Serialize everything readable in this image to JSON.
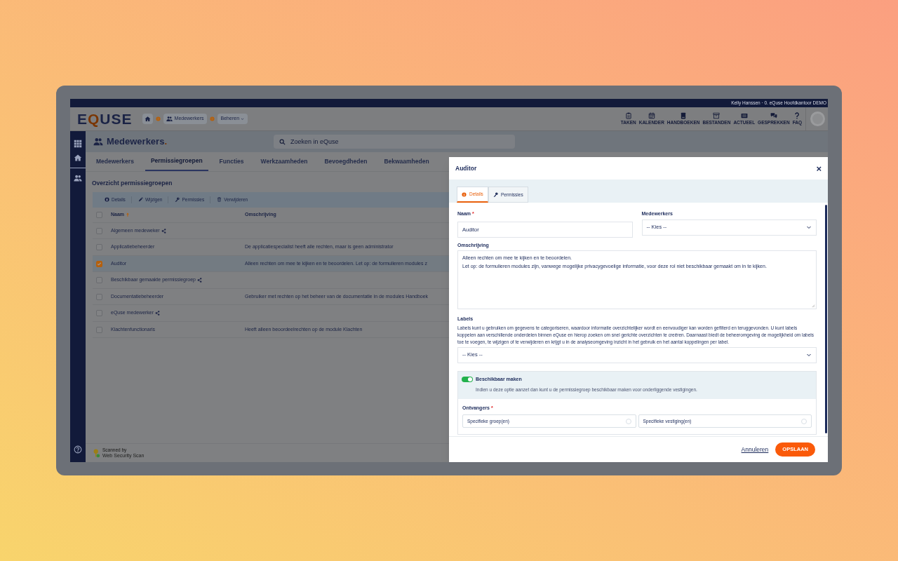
{
  "top_bar": {
    "user": "Kelly Hanssen · 0. eQuse Hoofdkantoor DEMO"
  },
  "header": {
    "logo": "EQUSE",
    "breadcrumbs": [
      {
        "kind": "home"
      },
      {
        "kind": "link",
        "label": "Medewerkers"
      },
      {
        "kind": "dropdown",
        "label": "Beheren"
      }
    ],
    "nav": [
      {
        "kind": "tasks",
        "label": "TAKEN"
      },
      {
        "kind": "calendar",
        "label": "KALENDER"
      },
      {
        "kind": "book",
        "label": "HANDBOEKEN"
      },
      {
        "kind": "archive",
        "label": "BESTANDEN"
      },
      {
        "kind": "news",
        "label": "ACTUEEL"
      },
      {
        "kind": "chat",
        "label": "GESPREKKEN"
      },
      {
        "kind": "faq",
        "label": "FAQ"
      }
    ]
  },
  "sidebar": {
    "items": [
      {
        "kind": "grid"
      },
      {
        "kind": "home"
      },
      {
        "kind": "users"
      }
    ],
    "help": {
      "kind": "help"
    }
  },
  "page": {
    "title": "Medewerkers",
    "title_mark": ".",
    "search": {
      "placeholder": "Zoeken in eQuse"
    },
    "tabs": [
      {
        "label": "Medewerkers",
        "selected": false
      },
      {
        "label": "Permissiegroepen",
        "selected": true
      },
      {
        "label": "Functies",
        "selected": false
      },
      {
        "label": "Werkzaamheden",
        "selected": false
      },
      {
        "label": "Bevoegdheden",
        "selected": false
      },
      {
        "label": "Bekwaamheden",
        "selected": false
      }
    ],
    "section_title": "Overzicht permissiegroepen",
    "toolbar": [
      {
        "kind": "info",
        "label": "Details"
      },
      {
        "kind": "edit",
        "label": "Wijzigen"
      },
      {
        "kind": "key",
        "label": "Permissies"
      },
      {
        "kind": "trash",
        "label": "Verwijderen"
      }
    ],
    "table": {
      "columns": [
        "Naam",
        "Omschrijving"
      ],
      "header_checked": false,
      "rows": [
        {
          "name": "Algemeen medeweker",
          "description": "",
          "checked": false,
          "selected": false,
          "shared": true
        },
        {
          "name": "Applicatiebeheerder",
          "description": "De applicatiespecialist heeft alle rechten, maar is geen administrator",
          "checked": false,
          "selected": false,
          "shared": false
        },
        {
          "name": "Auditor",
          "description": "Alleen rechten om mee te kijken en te beoordelen. Let op: de formulieren modules z",
          "checked": true,
          "selected": true,
          "shared": false
        },
        {
          "name": "Beschikbaar gemaakte permissiegroep",
          "description": "",
          "checked": false,
          "selected": false,
          "shared": true
        },
        {
          "name": "Documentatiebeheerder",
          "description": "Gebruiker met rechten op het beheer van de documentatie in de modules Handboek",
          "checked": false,
          "selected": false,
          "shared": false
        },
        {
          "name": "eQuse medewerker",
          "description": "",
          "checked": false,
          "selected": false,
          "shared": true
        },
        {
          "name": "Klachtenfunctionaris",
          "description": "Heeft alleen beoordeelrechten op de module Klachten",
          "checked": false,
          "selected": false,
          "shared": false
        }
      ]
    },
    "footer": {
      "line_1": "Scanned by",
      "line_2": "Web Security Scan"
    }
  },
  "modal": {
    "title": "Auditor",
    "close": "×",
    "tabs": [
      {
        "kind": "info",
        "label": "Details",
        "selected": true
      },
      {
        "kind": "key",
        "label": "Permissies",
        "selected": false
      }
    ],
    "naam": {
      "label": "Naam",
      "required_mark": "*",
      "value": "Auditor"
    },
    "medewerkers": {
      "label": "Medewerkers",
      "value": "-- Kies --"
    },
    "omschrijving": {
      "label": "Omschrijving",
      "lines": [
        "Alleen rechten om mee te kijken en te beoordelen.",
        "Let op: de formulieren modules zijn, vanwege mogelijke privacygevoelige informatie, voor deze rol niet beschikbaar gemaakt om in te kijken."
      ]
    },
    "labels": {
      "label": "Labels",
      "help": "Labels kunt u gebruiken om gegevens te categoriseren, waardoor informatie overzichtelijker wordt en eenvoudiger kan worden gefilterd en teruggevonden. U kunt labels koppelen aan verschillende onderdelen binnen eQuse en hierop zoeken om snel gerichte overzichten te creëren. Daarnaast biedt de beheeromgeving de mogelijkheid om labels toe te voegen, te wijzigen of te verwijderen en krijgt u in de analyseomgeving inzicht in het gebruik en het aantal koppelingen per label.",
      "value": "-- Kies --"
    },
    "available": {
      "label": "Beschikbaar maken",
      "on": true,
      "hint": "Indien u deze optie aanzet dan kunt u de permissiegroep beschikbaar maken voor onderliggende vestigingen."
    },
    "recipients": {
      "label": "Ontvangers",
      "required_mark": "*",
      "options": [
        {
          "label": "Specifieke groep(en)",
          "selected": false
        },
        {
          "label": "Specifieke vestiging(en)",
          "selected": false
        }
      ]
    },
    "buttons": {
      "cancel": "Annuleren",
      "save": "OPSLAAN"
    }
  }
}
